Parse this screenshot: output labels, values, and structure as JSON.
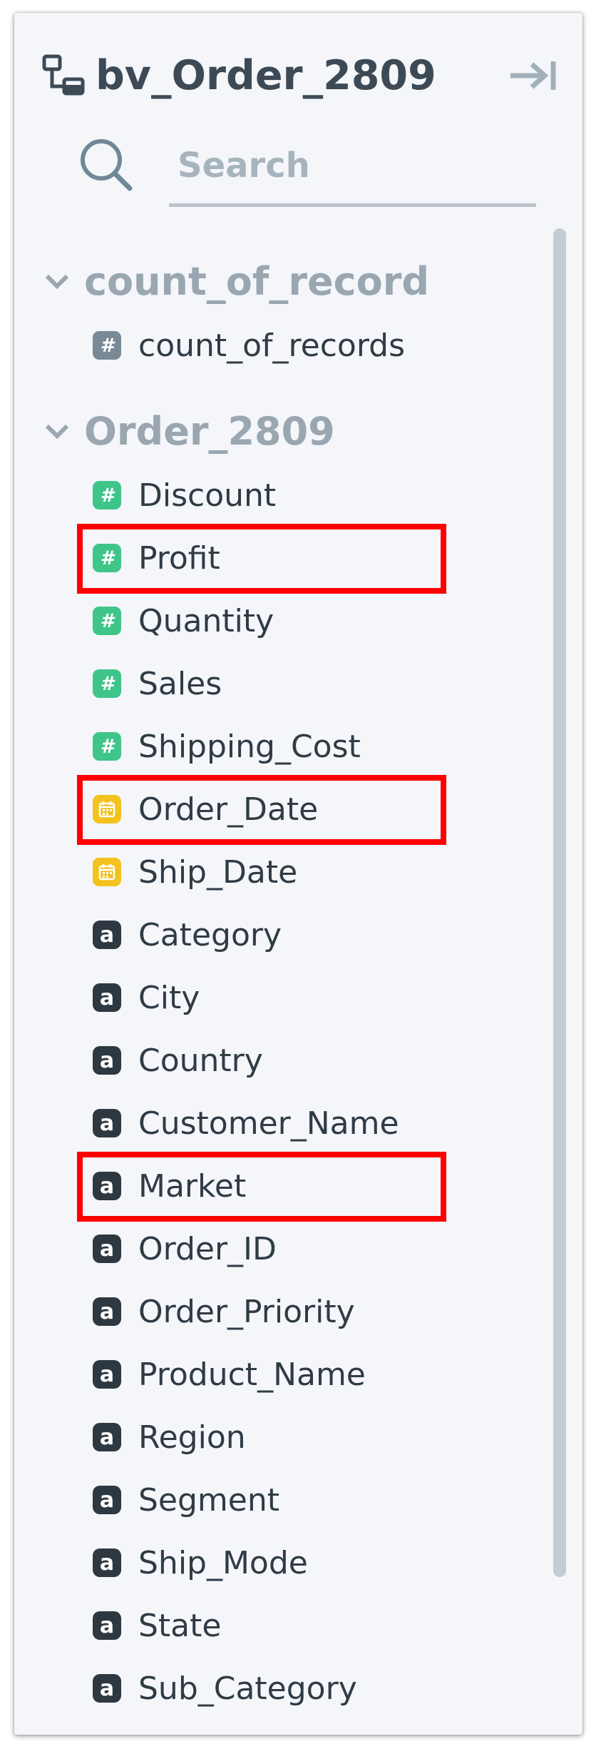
{
  "header": {
    "model_icon": "data-model-icon",
    "title": "bv_Order_2809",
    "collapse_icon": "collapse-panel-icon"
  },
  "search": {
    "icon": "search-icon",
    "placeholder": "Search"
  },
  "groups": [
    {
      "label": "count_of_record",
      "fields": [
        {
          "label": "count_of_records",
          "type": "count",
          "glyph": "#"
        }
      ]
    },
    {
      "label": "Order_2809",
      "fields": [
        {
          "label": "Discount",
          "type": "measure",
          "glyph": "#"
        },
        {
          "label": "Profit",
          "type": "measure",
          "glyph": "#",
          "highlighted": true
        },
        {
          "label": "Quantity",
          "type": "measure",
          "glyph": "#"
        },
        {
          "label": "Sales",
          "type": "measure",
          "glyph": "#"
        },
        {
          "label": "Shipping_Cost",
          "type": "measure",
          "glyph": "#"
        },
        {
          "label": "Order_Date",
          "type": "date",
          "glyph": "calendar",
          "highlighted": true
        },
        {
          "label": "Ship_Date",
          "type": "date",
          "glyph": "calendar"
        },
        {
          "label": "Category",
          "type": "dimension",
          "glyph": "a"
        },
        {
          "label": "City",
          "type": "dimension",
          "glyph": "a"
        },
        {
          "label": "Country",
          "type": "dimension",
          "glyph": "a"
        },
        {
          "label": "Customer_Name",
          "type": "dimension",
          "glyph": "a"
        },
        {
          "label": "Market",
          "type": "dimension",
          "glyph": "a",
          "highlighted": true
        },
        {
          "label": "Order_ID",
          "type": "dimension",
          "glyph": "a"
        },
        {
          "label": "Order_Priority",
          "type": "dimension",
          "glyph": "a"
        },
        {
          "label": "Product_Name",
          "type": "dimension",
          "glyph": "a"
        },
        {
          "label": "Region",
          "type": "dimension",
          "glyph": "a"
        },
        {
          "label": "Segment",
          "type": "dimension",
          "glyph": "a"
        },
        {
          "label": "Ship_Mode",
          "type": "dimension",
          "glyph": "a"
        },
        {
          "label": "State",
          "type": "dimension",
          "glyph": "a"
        },
        {
          "label": "Sub_Category",
          "type": "dimension",
          "glyph": "a"
        }
      ]
    }
  ],
  "colors": {
    "panel_bg": "#f4f6fa",
    "title": "#3d4a56",
    "group_label": "#9aa6b0",
    "measure": "#3fc58a",
    "date": "#f3c21e",
    "dimension": "#2e3840",
    "count": "#798995",
    "highlight": "#ff0000"
  }
}
